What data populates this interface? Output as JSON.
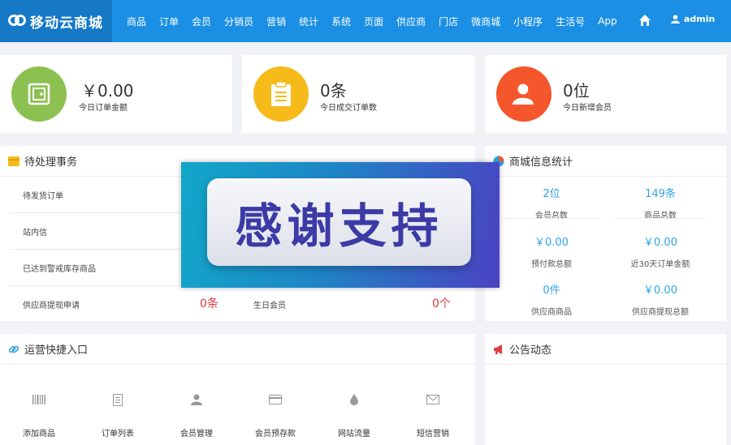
{
  "header": {
    "logo_text": "移动云商城",
    "nav": [
      "商品",
      "订单",
      "会员",
      "分销员",
      "营销",
      "统计",
      "系统",
      "页面",
      "供应商",
      "门店",
      "微商城",
      "小程序",
      "生活号",
      "App"
    ],
    "user": "admin"
  },
  "stats": [
    {
      "value": "￥0.00",
      "label": "今日订单金额",
      "color": "#8cc152",
      "icon": "safe-icon"
    },
    {
      "value": "0条",
      "label": "今日成交订单数",
      "color": "#f6bb1a",
      "icon": "clipboard-icon"
    },
    {
      "value": "0位",
      "label": "今日新增会员",
      "color": "#f5562b",
      "icon": "user-add-icon"
    }
  ],
  "pending": {
    "title": "待处理事务",
    "rows": [
      {
        "label": "待发货订单"
      },
      {
        "label": "站内信"
      },
      {
        "label": "已达到警戒库存商品"
      },
      {
        "label": "供应商提现申请",
        "value": "0条",
        "label2": "生日会员",
        "value2": "0个"
      }
    ]
  },
  "mall_stats": {
    "title": "商城信息统计",
    "items": [
      {
        "value": "2位",
        "label": "会员总数"
      },
      {
        "value": "149条",
        "label": "商品总数"
      },
      {
        "value": "￥0.00",
        "label": "预付款总额"
      },
      {
        "value": "￥0.00",
        "label": "近30天订单金额"
      },
      {
        "value": "0件",
        "label": "供应商商品"
      },
      {
        "value": "￥0.00",
        "label": "供应商提现总额"
      }
    ]
  },
  "quick": {
    "title": "运营快捷入口",
    "items": [
      {
        "label": "添加商品",
        "icon": "barcode-icon"
      },
      {
        "label": "订单列表",
        "icon": "list-icon"
      },
      {
        "label": "会员管理",
        "icon": "user-icon"
      },
      {
        "label": "会员预存款",
        "icon": "card-icon"
      },
      {
        "label": "网站流量",
        "icon": "drop-icon"
      },
      {
        "label": "短信营销",
        "icon": "mail-icon"
      }
    ]
  },
  "notice": {
    "title": "公告动态"
  },
  "overlay": {
    "text": "感谢支持"
  },
  "colors": {
    "header": "#1a8fe3",
    "logo_bg": "#1579c6",
    "accent": "#2fa4e7",
    "alert": "#e4393c"
  }
}
